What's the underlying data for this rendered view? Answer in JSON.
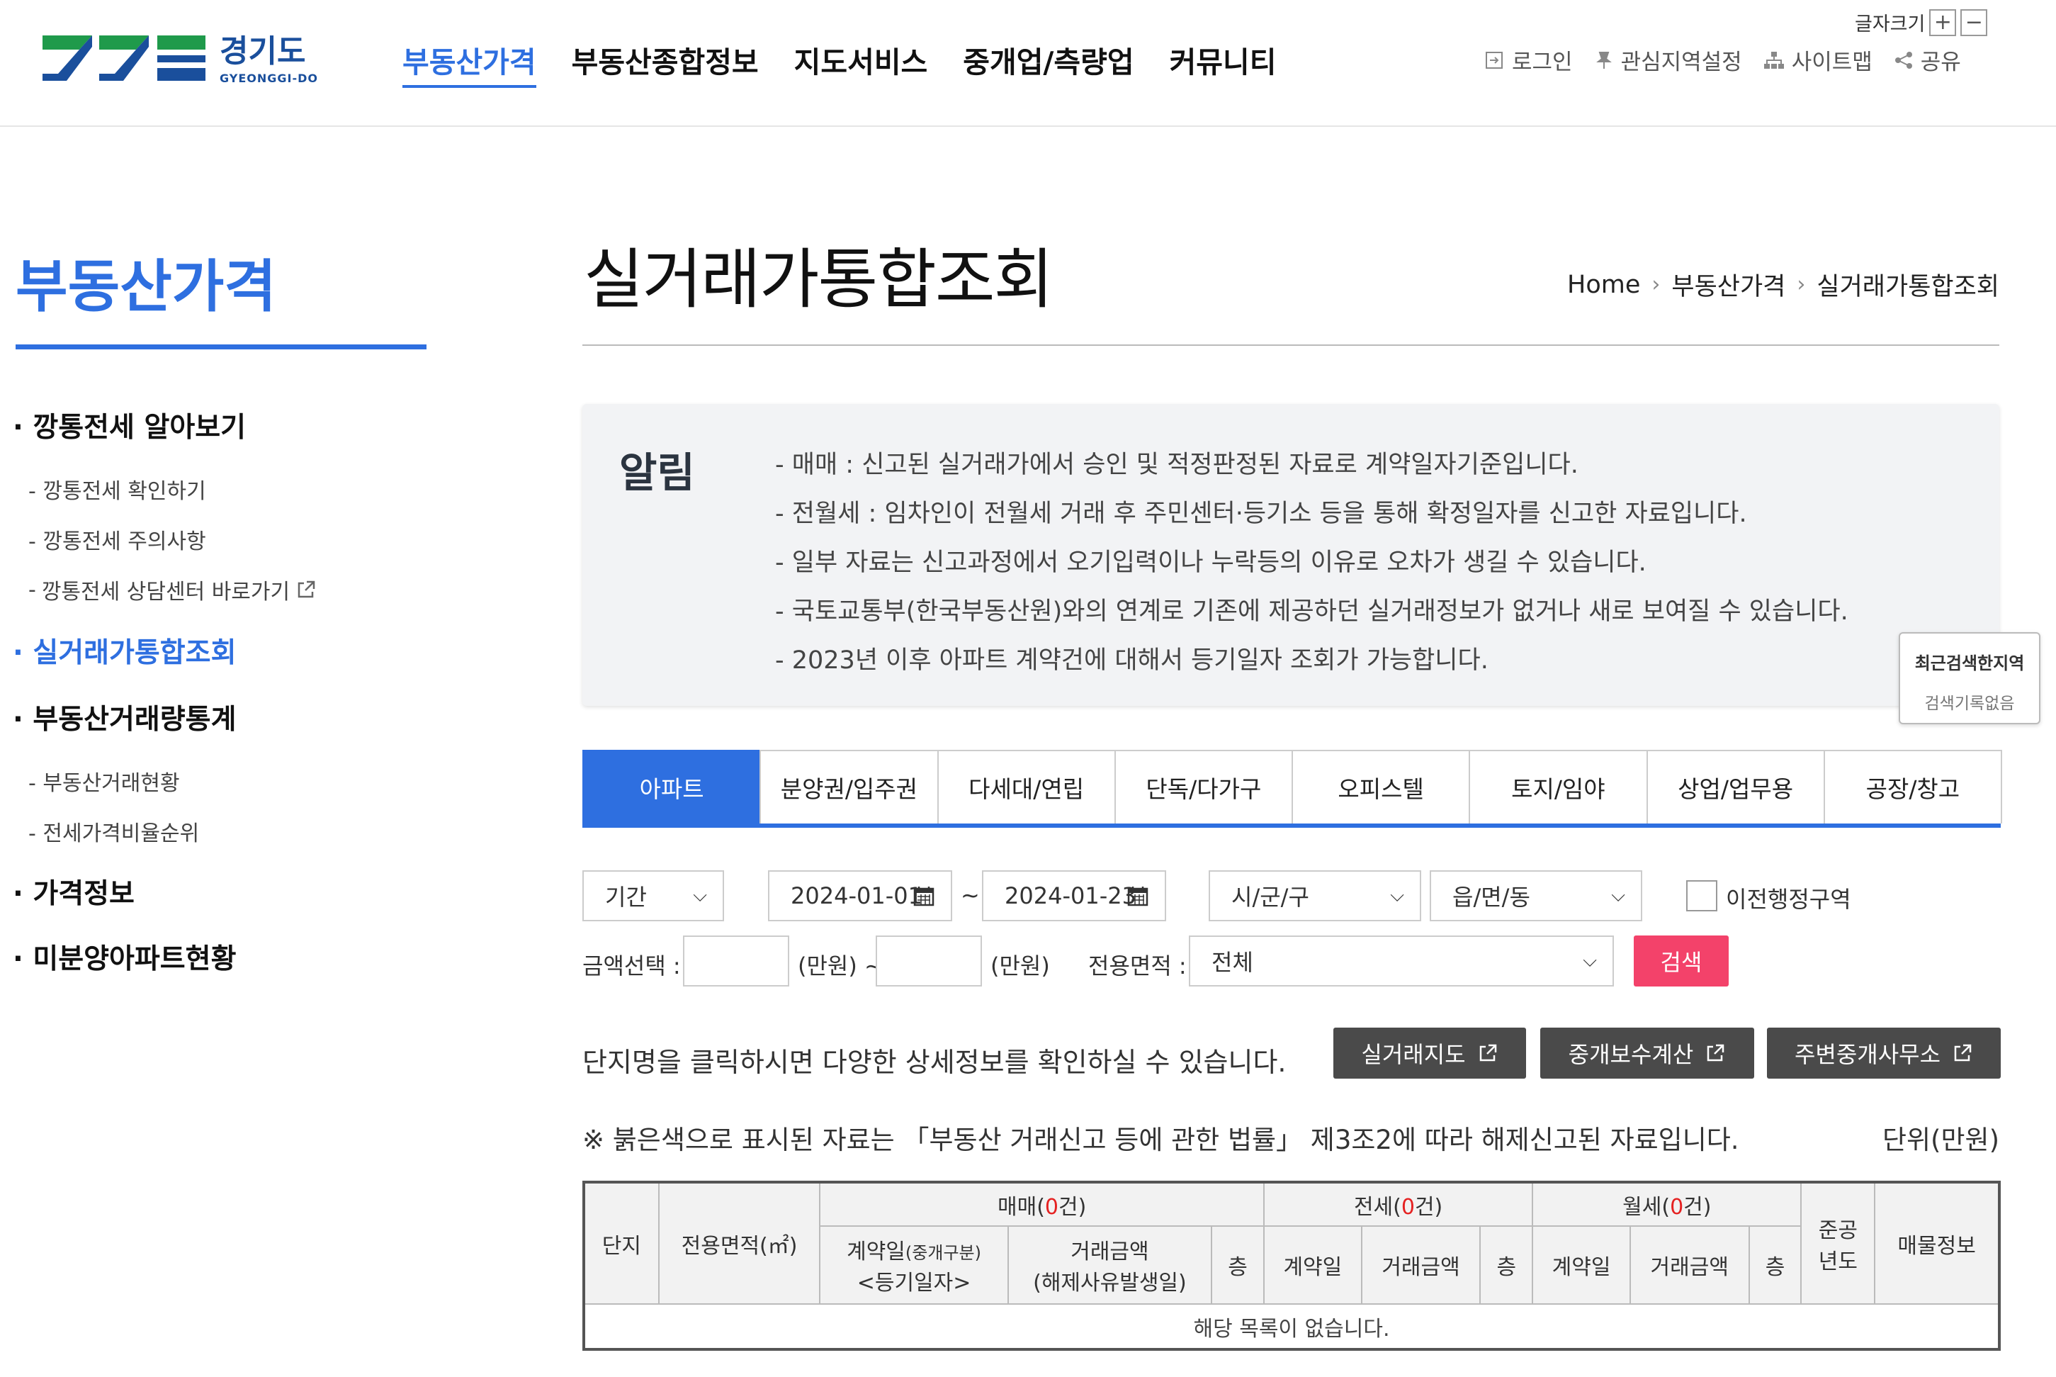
{
  "header": {
    "logo": {
      "ko": "경기도",
      "en": "GYEONGGI-DO"
    },
    "nav": [
      {
        "label": "부동산가격",
        "active": true
      },
      {
        "label": "부동산종합정보",
        "active": false
      },
      {
        "label": "지도서비스",
        "active": false
      },
      {
        "label": "중개업/측량업",
        "active": false
      },
      {
        "label": "커뮤니티",
        "active": false
      }
    ],
    "font_size_label": "글자크기",
    "font_plus": "+",
    "font_minus": "−",
    "util": {
      "login": "로그인",
      "interest": "관심지역설정",
      "sitemap": "사이트맵",
      "share": "공유"
    }
  },
  "sidebar": {
    "title": "부동산가격",
    "groups": [
      {
        "label": "깡통전세 알아보기",
        "active": false,
        "items": [
          "깡통전세 확인하기",
          "깡통전세 주의사항",
          "깡통전세 상담센터 바로가기"
        ]
      },
      {
        "label": "실거래가통합조회",
        "active": true,
        "items": []
      },
      {
        "label": "부동산거래량통계",
        "active": false,
        "items": [
          "부동산거래현황",
          "전세가격비율순위"
        ]
      },
      {
        "label": "가격정보",
        "active": false,
        "items": []
      },
      {
        "label": "미분양아파트현황",
        "active": false,
        "items": []
      }
    ]
  },
  "page": {
    "title": "실거래가통합조회",
    "breadcrumb": [
      "Home",
      "부동산가격",
      "실거래가통합조회"
    ]
  },
  "notice": {
    "title": "알림",
    "items": [
      "- 매매 : 신고된 실거래가에서 승인 및 적정판정된 자료로 계약일자기준입니다.",
      "- 전월세 : 임차인이 전월세 거래 후 주민센터·등기소 등을 통해 확정일자를 신고한 자료입니다.",
      "- 일부 자료는 신고과정에서 오기입력이나 누락등의 이유로 오차가 생길 수 있습니다.",
      "- 국토교통부(한국부동산원)와의 연계로 기존에 제공하던 실거래정보가 없거나 새로 보여질 수 있습니다.",
      "- 2023년 이후 아파트 계약건에 대해서 등기일자 조회가 가능합니다."
    ]
  },
  "recent": {
    "title": "최근검색한지역",
    "empty": "검색기록없음"
  },
  "tabs": [
    {
      "label": "아파트",
      "active": true
    },
    {
      "label": "분양권/입주권",
      "active": false
    },
    {
      "label": "다세대/연립",
      "active": false
    },
    {
      "label": "단독/다가구",
      "active": false
    },
    {
      "label": "오피스텔",
      "active": false
    },
    {
      "label": "토지/임야",
      "active": false
    },
    {
      "label": "상업/업무용",
      "active": false
    },
    {
      "label": "공장/창고",
      "active": false
    }
  ],
  "search": {
    "period": "기간",
    "date_from": "2024-01-01",
    "tilde": "~",
    "date_to": "2024-01-23",
    "sigungu": "시/군/구",
    "eupmyeondong": "읍/면/동",
    "old_admin": "이전행정구역",
    "price_label": "금액선택 :",
    "unit1": "(만원) ~",
    "unit2": "(만원)",
    "area_label": "전용면적 :",
    "area_value": "전체",
    "search_button": "검색"
  },
  "actions": {
    "info": "단지명을 클릭하시면 다양한 상세정보를 확인하실 수 있습니다.",
    "map_button": "실거래지도",
    "fee_button": "중개보수계산",
    "office_button": "주변중개사무소"
  },
  "law_notice": "※ 붉은색으로 표시된 자료는 「부동산 거래신고 등에 관한 법률」 제3조2에 따라 해제신고된 자료입니다.",
  "unit": "단위(만원)",
  "table": {
    "danji": "단지",
    "area": "전용면적(㎡)",
    "sale": "매매(",
    "jeonse": "전세(",
    "monthly": "월세(",
    "count_suffix": "건)",
    "sale_count": "0",
    "jeonse_count": "0",
    "monthly_count": "0",
    "contract_date": "계약일",
    "contract_type": "(중개구분)",
    "reg_date": "<등기일자>",
    "amount": "거래금액",
    "cancel_date": "(해제사유발생일)",
    "floor": "층",
    "built_year_1": "준공",
    "built_year_2": "년도",
    "listing": "매물정보",
    "empty": "해당 목록이 없습니다."
  },
  "colors": {
    "accent": "#2e6fe0",
    "search_btn": "#f3426a",
    "dark_btn": "#4a4a4a",
    "cancel_red": "#e52222"
  }
}
